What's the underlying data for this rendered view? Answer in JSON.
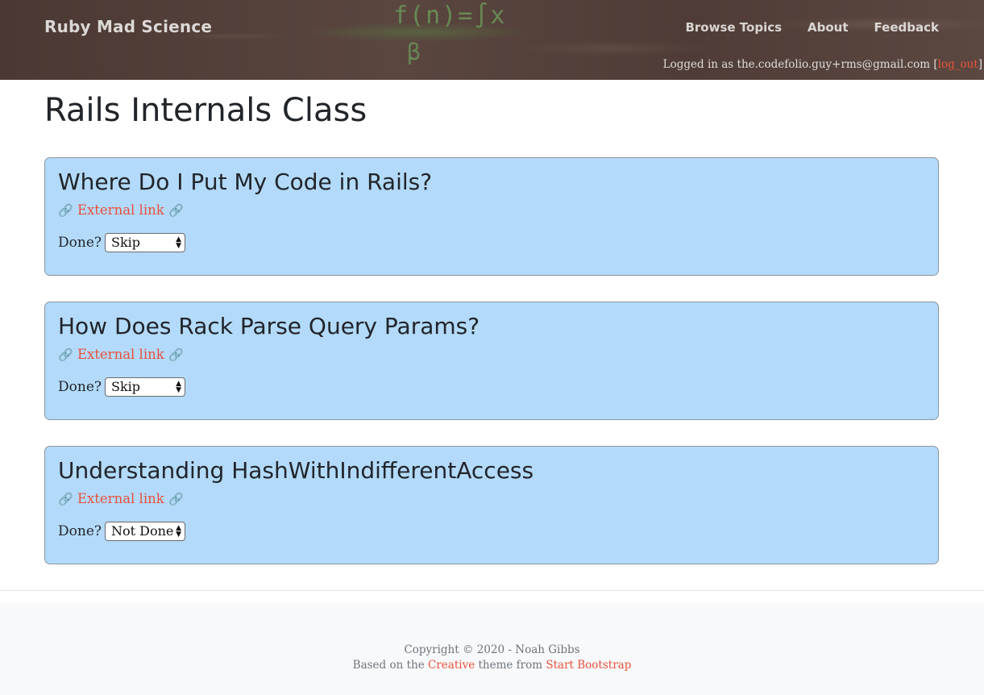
{
  "header": {
    "brand": "Ruby Mad Science",
    "nav": [
      "Browse Topics",
      "About",
      "Feedback"
    ],
    "login_prefix": "Logged in as the.codefolio.guy+rms@gmail.com [",
    "logout_label": "log_out",
    "login_suffix": "]"
  },
  "main": {
    "title": "Rails Internals Class",
    "cards": [
      {
        "title": "Where Do I Put My Code in Rails?",
        "link_label": "External link",
        "done_label": "Done?",
        "status": "Skip"
      },
      {
        "title": "How Does Rack Parse Query Params?",
        "link_label": "External link",
        "done_label": "Done?",
        "status": "Skip"
      },
      {
        "title": "Understanding HashWithIndifferentAccess",
        "link_label": "External link",
        "done_label": "Done?",
        "status": "Not Done"
      }
    ]
  },
  "footer": {
    "copyright": "Copyright © 2020 - Noah Gibbs",
    "based_prefix": "Based on the ",
    "creative_link": "Creative",
    "theme_from": " theme from ",
    "startbootstrap_link": "Start Bootstrap"
  },
  "icons": {
    "link": "🔗",
    "select_arrows": "▲▼"
  }
}
